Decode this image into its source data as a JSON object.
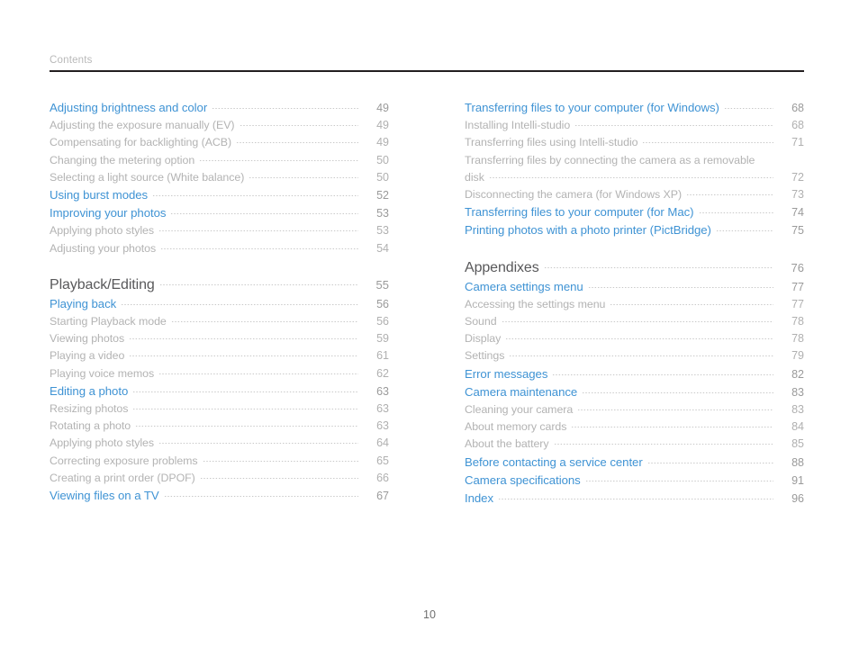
{
  "header": {
    "label": "Contents"
  },
  "footer": {
    "page_number": "10"
  },
  "colors": {
    "heading_blue": "#3f93d4",
    "section_gray": "#58585a",
    "subentry_gray": "#b3b3b3",
    "rule_dark": "#231f20",
    "header_label_gray": "#b9b9b9"
  },
  "left_column": [
    {
      "level": 2,
      "label": "Adjusting brightness and color",
      "page": "49"
    },
    {
      "level": 3,
      "label": "Adjusting the exposure manually (EV)",
      "page": "49"
    },
    {
      "level": 3,
      "label": "Compensating for backlighting (ACB)",
      "page": "49"
    },
    {
      "level": 3,
      "label": "Changing the metering option",
      "page": "50"
    },
    {
      "level": 3,
      "label": "Selecting a light source (White balance)",
      "page": "50"
    },
    {
      "level": 2,
      "label": "Using burst modes",
      "page": "52"
    },
    {
      "level": 2,
      "label": "Improving your photos",
      "page": "53"
    },
    {
      "level": 3,
      "label": "Applying photo styles",
      "page": "53"
    },
    {
      "level": 3,
      "label": "Adjusting your photos",
      "page": "54"
    },
    {
      "level": 0,
      "gap": true
    },
    {
      "level": 1,
      "label": "Playback/Editing",
      "page": "55"
    },
    {
      "level": 2,
      "label": "Playing back",
      "page": "56"
    },
    {
      "level": 3,
      "label": "Starting Playback mode",
      "page": "56"
    },
    {
      "level": 3,
      "label": "Viewing photos",
      "page": "59"
    },
    {
      "level": 3,
      "label": "Playing a video",
      "page": "61"
    },
    {
      "level": 3,
      "label": "Playing voice memos",
      "page": "62"
    },
    {
      "level": 2,
      "label": "Editing a photo",
      "page": "63"
    },
    {
      "level": 3,
      "label": "Resizing photos",
      "page": "63"
    },
    {
      "level": 3,
      "label": "Rotating a photo",
      "page": "63"
    },
    {
      "level": 3,
      "label": "Applying photo styles",
      "page": "64"
    },
    {
      "level": 3,
      "label": "Correcting exposure problems",
      "page": "65"
    },
    {
      "level": 3,
      "label": "Creating a print order (DPOF)",
      "page": "66"
    },
    {
      "level": 2,
      "label": "Viewing files on a TV",
      "page": "67"
    }
  ],
  "right_column": [
    {
      "level": 2,
      "label": "Transferring files to your computer (for Windows)",
      "page": "68"
    },
    {
      "level": 3,
      "label": "Installing Intelli-studio",
      "page": "68"
    },
    {
      "level": 3,
      "label": "Transferring files using Intelli-studio",
      "page": "71"
    },
    {
      "level": 3,
      "wrapped": true,
      "label_line1": "Transferring files by connecting the camera as a removable",
      "label_line2": "disk",
      "page": "72"
    },
    {
      "level": 3,
      "label": "Disconnecting the camera (for Windows XP)",
      "page": "73"
    },
    {
      "level": 2,
      "label": "Transferring files to your computer (for Mac)",
      "page": "74"
    },
    {
      "level": 2,
      "label": "Printing photos with a photo printer (PictBridge)",
      "page": "75"
    },
    {
      "level": 0,
      "gap": true
    },
    {
      "level": 1,
      "label": "Appendixes",
      "page": "76"
    },
    {
      "level": 2,
      "label": "Camera settings menu",
      "page": "77"
    },
    {
      "level": 3,
      "label": "Accessing the settings menu",
      "page": "77"
    },
    {
      "level": 3,
      "label": "Sound",
      "page": "78"
    },
    {
      "level": 3,
      "label": "Display",
      "page": "78"
    },
    {
      "level": 3,
      "label": "Settings",
      "page": "79"
    },
    {
      "level": 2,
      "label": "Error messages",
      "page": "82"
    },
    {
      "level": 2,
      "label": "Camera maintenance",
      "page": "83"
    },
    {
      "level": 3,
      "label": "Cleaning your camera",
      "page": "83"
    },
    {
      "level": 3,
      "label": "About memory cards",
      "page": "84"
    },
    {
      "level": 3,
      "label": "About the battery",
      "page": "85"
    },
    {
      "level": 2,
      "label": "Before contacting a service center",
      "page": "88"
    },
    {
      "level": 2,
      "label": "Camera specifications",
      "page": "91"
    },
    {
      "level": 2,
      "label": "Index",
      "page": "96"
    }
  ]
}
